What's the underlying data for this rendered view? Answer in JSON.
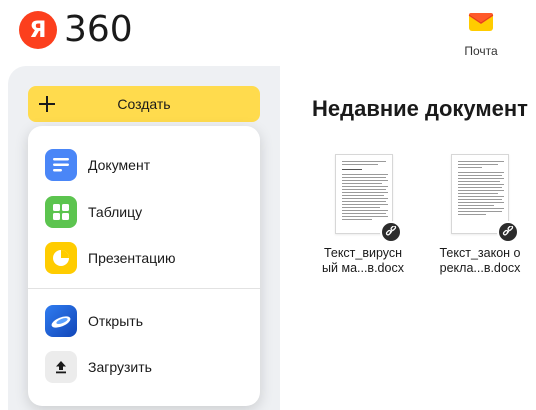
{
  "header": {
    "logo_letter": "Я",
    "logo_text": "360",
    "mail_label": "Почта"
  },
  "create": {
    "label": "Создать"
  },
  "menu": {
    "items": [
      {
        "label": "Документ",
        "icon": "document-icon",
        "color": "#4a86f7"
      },
      {
        "label": "Таблицу",
        "icon": "spreadsheet-icon",
        "color": "#5cc44f"
      },
      {
        "label": "Презентацию",
        "icon": "presentation-icon",
        "color": "#ffcc00"
      },
      {
        "label": "Открыть",
        "icon": "open-disk-icon",
        "color": "#1f63d4"
      },
      {
        "label": "Загрузить",
        "icon": "upload-icon",
        "color": "#ececec"
      }
    ]
  },
  "main": {
    "title": "Недавние документ",
    "docs": [
      {
        "line1": "Текст_вирусн",
        "line2": "ый ма...в.docx"
      },
      {
        "line1": "Текст_закон о",
        "line2": "рекла...в.docx"
      }
    ]
  },
  "colors": {
    "accent_yellow": "#ffdb4d",
    "brand_red": "#fc3f1d",
    "panel_bg": "#eef0f3"
  }
}
